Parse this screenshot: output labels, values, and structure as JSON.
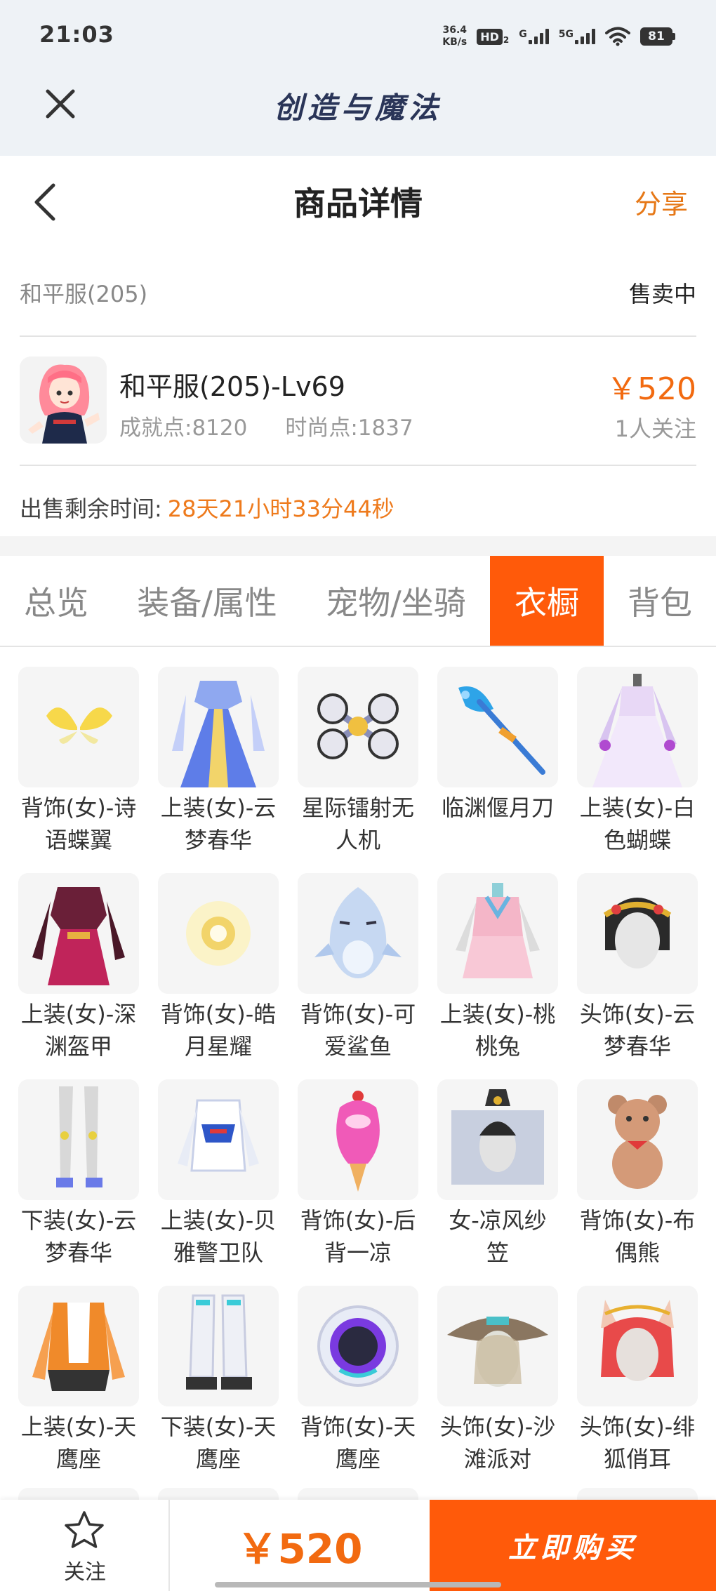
{
  "status_bar": {
    "time": "21:03",
    "net_speed_value": "36.4",
    "net_speed_unit": "KB/s",
    "hd_label": "HD",
    "hd_sub": "2",
    "signal1_label": "G",
    "signal2_label": "5G",
    "battery_level": "81"
  },
  "app_bar": {
    "title": "创造与魔法"
  },
  "nav": {
    "title": "商品详情",
    "share_label": "分享"
  },
  "server": {
    "name": "和平服(205)",
    "status": "售卖中"
  },
  "character": {
    "name": "和平服(205)-Lv69",
    "achievement": "成就点:8120",
    "fashion": "时尚点:1837",
    "price": "￥520",
    "followers": "1人关注"
  },
  "remaining": {
    "label": "出售剩余时间:",
    "value": "28天21小时33分44秒"
  },
  "tabs": [
    {
      "label": "总览"
    },
    {
      "label": "装备/属性"
    },
    {
      "label": "宠物/坐骑"
    },
    {
      "label": "衣橱"
    },
    {
      "label": "背包"
    }
  ],
  "active_tab": "衣橱",
  "wardrobe": [
    {
      "line1": "背饰(女)-诗",
      "line2": "语蝶翼",
      "icon": "butterfly-wings-icon"
    },
    {
      "line1": "上装(女)-云",
      "line2": "梦春华",
      "icon": "blue-dress-icon"
    },
    {
      "line1": "星际镭射无",
      "line2": "人机",
      "icon": "drone-icon"
    },
    {
      "line1": "临渊偃月刀",
      "line2": "",
      "icon": "glaive-icon"
    },
    {
      "line1": "上装(女)-白",
      "line2": "色蝴蝶",
      "icon": "white-gown-icon"
    },
    {
      "line1": "上装(女)-深",
      "line2": "渊盔甲",
      "icon": "abyss-armor-icon"
    },
    {
      "line1": "背饰(女)-皓",
      "line2": "月星耀",
      "icon": "moon-glow-icon"
    },
    {
      "line1": "背饰(女)-可",
      "line2": "爱鲨鱼",
      "icon": "shark-icon"
    },
    {
      "line1": "上装(女)-桃",
      "line2": "桃兔",
      "icon": "pink-dress-icon"
    },
    {
      "line1": "头饰(女)-云",
      "line2": "梦春华",
      "icon": "headdress-icon"
    },
    {
      "line1": "下装(女)-云",
      "line2": "梦春华",
      "icon": "stockings-icon"
    },
    {
      "line1": "上装(女)-贝",
      "line2": "雅警卫队",
      "icon": "guard-jacket-icon"
    },
    {
      "line1": "背饰(女)-后",
      "line2": "背一凉",
      "icon": "ice-cream-icon"
    },
    {
      "line1": "女-凉风纱",
      "line2": "笠",
      "icon": "veil-hat-icon"
    },
    {
      "line1": "背饰(女)-布",
      "line2": "偶熊",
      "icon": "teddy-bear-icon"
    },
    {
      "line1": "上装(女)-天",
      "line2": "鹰座",
      "icon": "orange-jacket-icon"
    },
    {
      "line1": "下装(女)-天",
      "line2": "鹰座",
      "icon": "boots-icon"
    },
    {
      "line1": "背饰(女)-天",
      "line2": "鹰座",
      "icon": "orb-backpack-icon"
    },
    {
      "line1": "头饰(女)-沙",
      "line2": "滩派对",
      "icon": "sun-hat-icon"
    },
    {
      "line1": "头饰(女)-绯",
      "line2": "狐俏耳",
      "icon": "fox-ears-icon"
    }
  ],
  "bottom_bar": {
    "follow_label": "关注",
    "price": "￥520",
    "buy_label": "立即购买"
  },
  "colors": {
    "accent": "#ff5a0a",
    "price": "#f26a10",
    "share": "#e67817"
  }
}
